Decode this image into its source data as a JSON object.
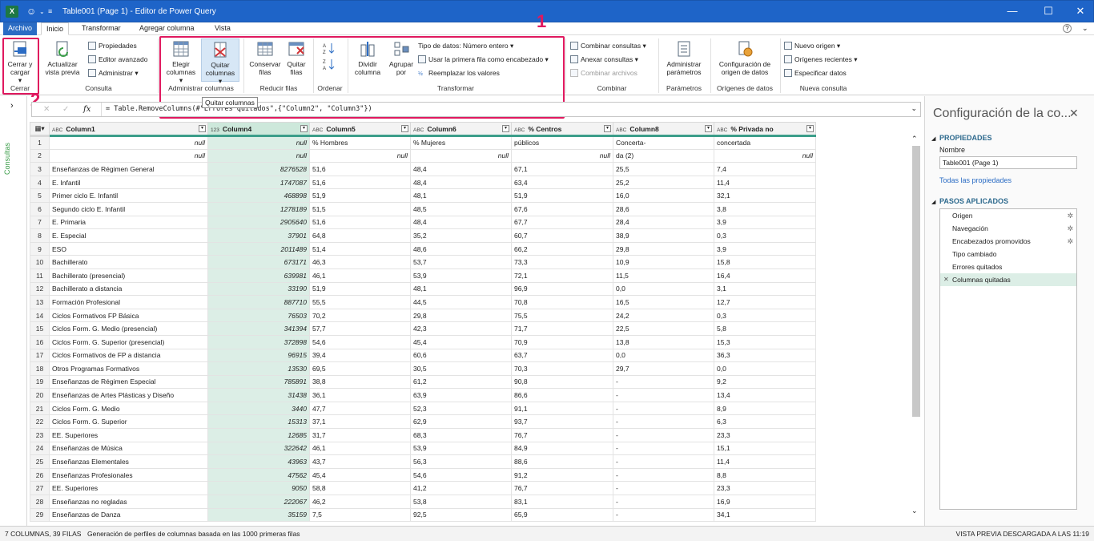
{
  "title_bar": {
    "app_badge": "X",
    "title": "Table001 (Page 1) - Editor de Power Query",
    "minimize": "—",
    "maximize": "☐",
    "close": "✕"
  },
  "tabs": [
    "Archivo",
    "Inicio",
    "Transformar",
    "Agregar columna",
    "Vista"
  ],
  "help_icon": "?",
  "ribbon": {
    "cerrar": {
      "button": "Cerrar y cargar",
      "group": "Cerrar"
    },
    "consulta": {
      "actualizar": "Actualizar vista previa",
      "propiedades": "Propiedades",
      "editor": "Editor avanzado",
      "administrar": "Administrar",
      "group": "Consulta"
    },
    "admin_col": {
      "elegir": "Elegir columnas",
      "quitar": "Quitar columnas",
      "group": "Administrar columnas"
    },
    "reducir": {
      "conservar": "Conservar filas",
      "quitar": "Quitar filas",
      "group": "Reducir filas"
    },
    "ordenar": {
      "group": "Ordenar"
    },
    "transformar": {
      "dividir": "Dividir columna",
      "agrupar": "Agrupar por",
      "tipo": "Tipo de datos: Número entero",
      "primera": "Usar la primera fila como encabezado",
      "reemplazar": "Reemplazar los valores",
      "group": "Transformar"
    },
    "combinar": {
      "combinar": "Combinar consultas",
      "anexar": "Anexar consultas",
      "archivos": "Combinar archivos",
      "group": "Combinar"
    },
    "parametros": {
      "admin": "Administrar parámetros",
      "group": "Parámetros"
    },
    "origenes": {
      "config": "Configuración de origen de datos",
      "group": "Orígenes de datos"
    },
    "nueva": {
      "nuevo": "Nuevo origen",
      "recientes": "Orígenes recientes",
      "especificar": "Especificar datos",
      "group": "Nueva consulta"
    }
  },
  "annotations": {
    "one": "1",
    "two": "2"
  },
  "tooltip": "Quitar columnas",
  "queries_label": "Consultas",
  "formula": {
    "fx": "fx",
    "text": "= Table.RemoveColumns(#\"Errores quitados\",{\"Column2\", \"Column3\"})"
  },
  "grid": {
    "columns": [
      {
        "type": "ABC",
        "name": "Column1"
      },
      {
        "type": "123",
        "name": "Column4"
      },
      {
        "type": "ABC",
        "name": "Column5"
      },
      {
        "type": "ABC",
        "name": "Column6"
      },
      {
        "type": "ABC",
        "name": "% Centros"
      },
      {
        "type": "ABC",
        "name": "Column8"
      },
      {
        "type": "ABC",
        "name": "% Privada no"
      }
    ],
    "rows": [
      [
        "1",
        "null",
        "null",
        "% Hombres",
        "% Mujeres",
        "públicos",
        "Concerta-",
        "concertada"
      ],
      [
        "2",
        "null",
        "null",
        "null",
        "null",
        "null",
        "da (2)",
        "null"
      ],
      [
        "3",
        "Enseñanzas de Régimen General",
        "8276528",
        "51,6",
        "48,4",
        "67,1",
        "25,5",
        "7,4"
      ],
      [
        "4",
        "E. Infantil",
        "1747087",
        "51,6",
        "48,4",
        "63,4",
        "25,2",
        "11,4"
      ],
      [
        "5",
        "Primer ciclo E. Infantil",
        "468898",
        "51,9",
        "48,1",
        "51,9",
        "16,0",
        "32,1"
      ],
      [
        "6",
        "Segundo ciclo E. Infantil",
        "1278189",
        "51,5",
        "48,5",
        "67,6",
        "28,6",
        "3,8"
      ],
      [
        "7",
        "E. Primaria",
        "2905640",
        "51,6",
        "48,4",
        "67,7",
        "28,4",
        "3,9"
      ],
      [
        "8",
        "E. Especial",
        "37901",
        "64,8",
        "35,2",
        "60,7",
        "38,9",
        "0,3"
      ],
      [
        "9",
        "ESO",
        "2011489",
        "51,4",
        "48,6",
        "66,2",
        "29,8",
        "3,9"
      ],
      [
        "10",
        "Bachillerato",
        "673171",
        "46,3",
        "53,7",
        "73,3",
        "10,9",
        "15,8"
      ],
      [
        "11",
        "Bachillerato (presencial)",
        "639981",
        "46,1",
        "53,9",
        "72,1",
        "11,5",
        "16,4"
      ],
      [
        "12",
        "Bachillerato a distancia",
        "33190",
        "51,9",
        "48,1",
        "96,9",
        "0,0",
        "3,1"
      ],
      [
        "13",
        "Formación Profesional",
        "887710",
        "55,5",
        "44,5",
        "70,8",
        "16,5",
        "12,7"
      ],
      [
        "14",
        "Ciclos Formativos FP Básica",
        "76503",
        "70,2",
        "29,8",
        "75,5",
        "24,2",
        "0,3"
      ],
      [
        "15",
        "Ciclos Form. G. Medio (presencial)",
        "341394",
        "57,7",
        "42,3",
        "71,7",
        "22,5",
        "5,8"
      ],
      [
        "16",
        "Ciclos Form. G. Superior (presencial)",
        "372898",
        "54,6",
        "45,4",
        "70,9",
        "13,8",
        "15,3"
      ],
      [
        "17",
        "Ciclos Formativos de FP a distancia",
        "96915",
        "39,4",
        "60,6",
        "63,7",
        "0,0",
        "36,3"
      ],
      [
        "18",
        "Otros Programas Formativos",
        "13530",
        "69,5",
        "30,5",
        "70,3",
        "29,7",
        "0,0"
      ],
      [
        "19",
        "Enseñanzas de Régimen Especial",
        "785891",
        "38,8",
        "61,2",
        "90,8",
        "-",
        "9,2"
      ],
      [
        "20",
        "Enseñanzas de Artes Plásticas y Diseño",
        "31438",
        "36,1",
        "63,9",
        "86,6",
        "-",
        "13,4"
      ],
      [
        "21",
        "Ciclos Form. G. Medio",
        "3440",
        "47,7",
        "52,3",
        "91,1",
        "-",
        "8,9"
      ],
      [
        "22",
        "Ciclos Form. G. Superior",
        "15313",
        "37,1",
        "62,9",
        "93,7",
        "-",
        "6,3"
      ],
      [
        "23",
        "EE. Superiores",
        "12685",
        "31,7",
        "68,3",
        "76,7",
        "-",
        "23,3"
      ],
      [
        "24",
        "Enseñanzas de Música",
        "322642",
        "46,1",
        "53,9",
        "84,9",
        "-",
        "15,1"
      ],
      [
        "25",
        "Enseñanzas Elementales",
        "43963",
        "43,7",
        "56,3",
        "88,6",
        "-",
        "11,4"
      ],
      [
        "26",
        "Enseñanzas Profesionales",
        "47562",
        "45,4",
        "54,6",
        "91,2",
        "-",
        "8,8"
      ],
      [
        "27",
        "EE. Superiores",
        "9050",
        "58,8",
        "41,2",
        "76,7",
        "-",
        "23,3"
      ],
      [
        "28",
        "Enseñanzas no regladas",
        "222067",
        "46,2",
        "53,8",
        "83,1",
        "-",
        "16,9"
      ],
      [
        "29",
        "Enseñanzas de Danza",
        "35159",
        "7,5",
        "92,5",
        "65,9",
        "-",
        "34,1"
      ]
    ]
  },
  "right_pane": {
    "title": "Configuración de la co...",
    "props_header": "PROPIEDADES",
    "name_label": "Nombre",
    "name_value": "Table001 (Page 1)",
    "all_props": "Todas las propiedades",
    "steps_header": "PASOS APLICADOS",
    "steps": [
      "Origen",
      "Navegación",
      "Encabezados promovidos",
      "Tipo cambiado",
      "Errores quitados",
      "Columnas quitadas"
    ]
  },
  "status": {
    "left": "7 COLUMNAS, 39 FILAS",
    "middle": "Generación de perfiles de columnas basada en las 1000 primeras filas",
    "right": "VISTA PREVIA DESCARGADA A LAS 11:19"
  },
  "colors": {
    "accent": "#1e64c8",
    "annotation": "#e0195f",
    "selected_col": "#dceee6"
  }
}
